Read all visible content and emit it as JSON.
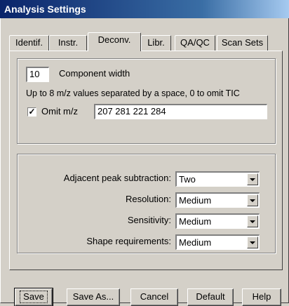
{
  "window": {
    "title": "Analysis Settings"
  },
  "tabs": [
    {
      "label": "Identif."
    },
    {
      "label": "Instr."
    },
    {
      "label": "Deconv."
    },
    {
      "label": "Libr."
    },
    {
      "label": "QA/QC"
    },
    {
      "label": "Scan Sets"
    }
  ],
  "active_tab": "Deconv.",
  "deconv": {
    "component_width": {
      "value": "10",
      "label": "Component width"
    },
    "help_text": "Up to 8 m/z values separated by a space, 0 to omit TIC",
    "omit_mz": {
      "checked": true,
      "check_glyph": "✓",
      "label": "Omit m/z",
      "value": "207 281 221 284"
    },
    "settings": [
      {
        "label": "Adjacent peak subtraction:",
        "value": "Two"
      },
      {
        "label": "Resolution:",
        "value": "Medium"
      },
      {
        "label": "Sensitivity:",
        "value": "Medium"
      },
      {
        "label": "Shape requirements:",
        "value": "Medium"
      }
    ]
  },
  "buttons": {
    "save": "Save",
    "save_as": "Save As...",
    "cancel": "Cancel",
    "default": "Default",
    "help": "Help"
  },
  "colors": {
    "face": "#d4d0c8",
    "title_start": "#0a246a",
    "title_end": "#a6caf0"
  }
}
